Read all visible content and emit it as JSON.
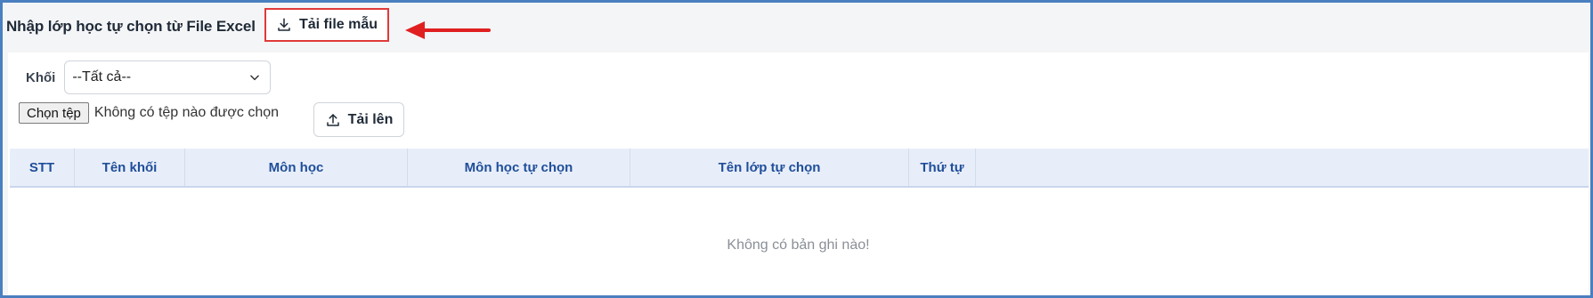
{
  "header": {
    "title": "Nhập lớp học tự chọn từ File Excel",
    "download_label": "Tải file mẫu"
  },
  "filter": {
    "label": "Khối",
    "selected": "--Tất cả--"
  },
  "file": {
    "choose_label": "Chọn tệp",
    "status": "Không có tệp nào được chọn",
    "upload_label": "Tải lên"
  },
  "table": {
    "columns": [
      "STT",
      "Tên khối",
      "Môn học",
      "Môn học tự chọn",
      "Tên lớp tự chọn",
      "Thứ tự",
      ""
    ],
    "empty_text": "Không có bản ghi nào!"
  },
  "colors": {
    "highlight": "#e03a3a",
    "header_text": "#1f4e9a",
    "table_header_bg": "#e8eef9"
  },
  "icons": {
    "download": "download-icon",
    "upload": "upload-icon",
    "dropdown": "chevron-down-icon"
  }
}
